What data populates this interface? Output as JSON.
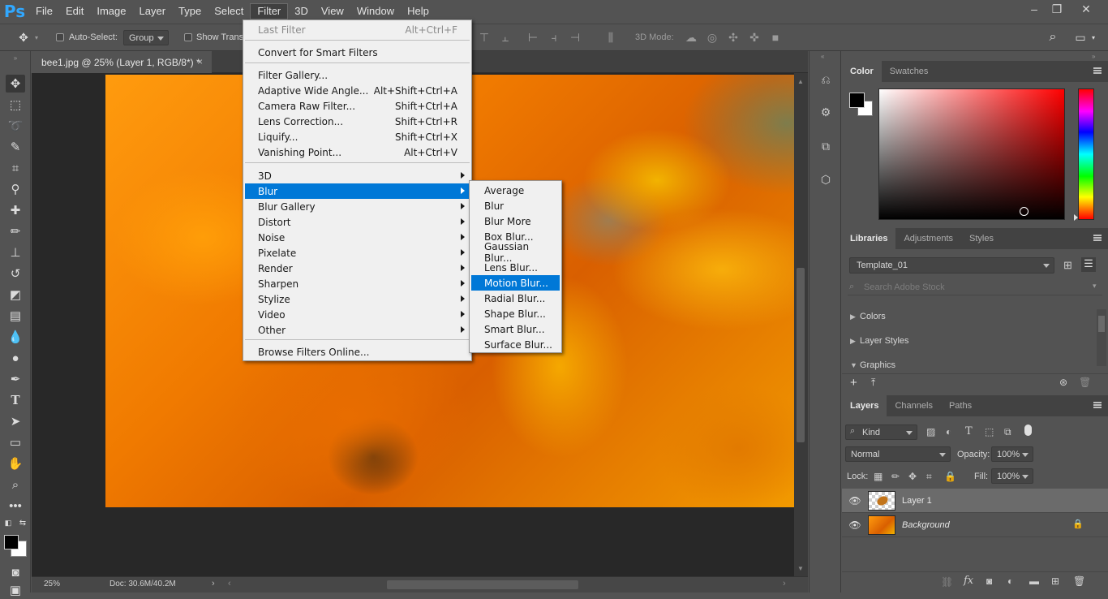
{
  "app": {
    "logo": "Ps"
  },
  "menubar": {
    "items": [
      "File",
      "Edit",
      "Image",
      "Layer",
      "Type",
      "Select",
      "Filter",
      "3D",
      "View",
      "Window",
      "Help"
    ],
    "active": "Filter"
  },
  "window_controls": {
    "minimize": "–",
    "restore": "❐",
    "close": "✕"
  },
  "options": {
    "auto_select_label": "Auto-Select:",
    "auto_select_target": "Group",
    "show_transform_label": "Show Transf",
    "mode_3d_label": "3D Mode:"
  },
  "document": {
    "tab_title": "bee1.jpg @ 25% (Layer 1, RGB/8*) *",
    "close": "×",
    "zoom": "25%",
    "doc_size": "Doc: 30.6M/40.2M"
  },
  "filter_menu": {
    "last_filter": {
      "label": "Last Filter",
      "shortcut": "Alt+Ctrl+F"
    },
    "convert": "Convert for Smart Filters",
    "gallery": {
      "label": "Filter Gallery..."
    },
    "adaptive": {
      "label": "Adaptive Wide Angle...",
      "shortcut": "Alt+Shift+Ctrl+A"
    },
    "camera_raw": {
      "label": "Camera Raw Filter...",
      "shortcut": "Shift+Ctrl+A"
    },
    "lens_correction": {
      "label": "Lens Correction...",
      "shortcut": "Shift+Ctrl+R"
    },
    "liquify": {
      "label": "Liquify...",
      "shortcut": "Shift+Ctrl+X"
    },
    "vanishing": {
      "label": "Vanishing Point...",
      "shortcut": "Alt+Ctrl+V"
    },
    "submenus": [
      "3D",
      "Blur",
      "Blur Gallery",
      "Distort",
      "Noise",
      "Pixelate",
      "Render",
      "Sharpen",
      "Stylize",
      "Video",
      "Other"
    ],
    "highlighted": "Blur",
    "browse": "Browse Filters Online..."
  },
  "blur_menu": {
    "items": [
      "Average",
      "Blur",
      "Blur More",
      "Box Blur...",
      "Gaussian Blur...",
      "Lens Blur...",
      "Motion Blur...",
      "Radial Blur...",
      "Shape Blur...",
      "Smart Blur...",
      "Surface Blur..."
    ],
    "highlighted": "Motion Blur..."
  },
  "color_panel": {
    "tabs": [
      "Color",
      "Swatches"
    ],
    "fg": "#000000",
    "bg": "#ffffff"
  },
  "libraries_panel": {
    "tabs": [
      "Libraries",
      "Adjustments",
      "Styles"
    ],
    "library_name": "Template_01",
    "search_placeholder": "Search Adobe Stock",
    "sections": [
      "Colors",
      "Layer Styles",
      "Graphics"
    ]
  },
  "layers_panel": {
    "tabs": [
      "Layers",
      "Channels",
      "Paths"
    ],
    "filter_kind": "Kind",
    "blend_mode": "Normal",
    "opacity_label": "Opacity:",
    "opacity": "100%",
    "lock_label": "Lock:",
    "fill_label": "Fill:",
    "fill": "100%",
    "layers": [
      {
        "name": "Layer 1",
        "selected": true
      },
      {
        "name": "Background",
        "selected": false,
        "locked": true
      }
    ]
  },
  "colors": {
    "accent": "#0078d7",
    "logo": "#31a8ff"
  }
}
